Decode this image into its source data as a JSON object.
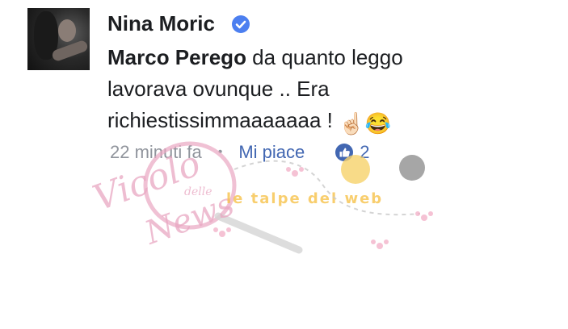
{
  "comment": {
    "author": "Nina Moric",
    "mention": "Marco Perego",
    "text": " da quanto leggo lavorava ovunque .. Era richiestissimmaaaaaaa ! ",
    "emojis": "☝🏻😂"
  },
  "meta": {
    "time": "22 minuti fa",
    "separator": "•",
    "like_label": "Mi piace",
    "like_count": "2"
  },
  "watermark": {
    "brand_line1": "Vicolo",
    "brand_small": "delle",
    "brand_line2": "News",
    "partner": "le talpe del web"
  },
  "colors": {
    "link_blue": "#4267b2",
    "meta_gray": "#90949c",
    "verified_blue": "#4c7ff0"
  },
  "icons": {
    "verified": "verified-badge-icon",
    "like": "thumbs-up-icon"
  }
}
